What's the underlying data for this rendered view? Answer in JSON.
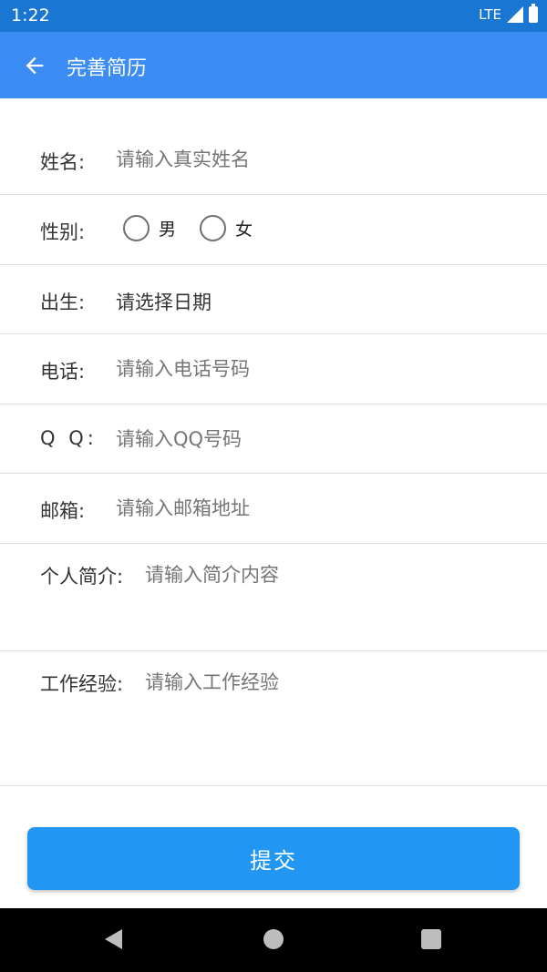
{
  "status_bar": {
    "time": "1:22",
    "network": "LTE"
  },
  "app_bar": {
    "title": "完善简历"
  },
  "form": {
    "name": {
      "label": "姓名:",
      "placeholder": "请输入真实姓名"
    },
    "gender": {
      "label": "性别:",
      "options": [
        "男",
        "女"
      ]
    },
    "birth": {
      "label": "出生:",
      "placeholder": "请选择日期"
    },
    "phone": {
      "label": "电话:",
      "placeholder": "请输入电话号码"
    },
    "qq": {
      "label": "Q Q:",
      "placeholder": "请输入QQ号码"
    },
    "email": {
      "label": "邮箱:",
      "placeholder": "请输入邮箱地址"
    },
    "intro": {
      "label": "个人简介:",
      "placeholder": "请输入简介内容"
    },
    "experience": {
      "label": "工作经验:",
      "placeholder": "请输入工作经验"
    }
  },
  "submit": {
    "label": "提交"
  },
  "colors": {
    "status_bar": "#1976d2",
    "app_bar": "#3b8cf4",
    "button": "#2196f3"
  }
}
